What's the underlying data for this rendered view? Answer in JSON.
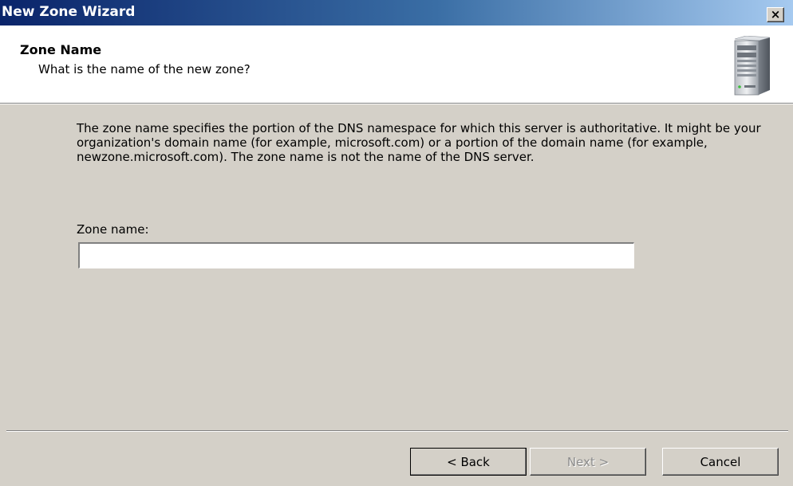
{
  "window": {
    "title": "New Zone Wizard",
    "close_label": "×"
  },
  "header": {
    "title": "Zone Name",
    "subtitle": "What is the name of the new zone?",
    "icon": "server-icon"
  },
  "body": {
    "description": "The zone name specifies the portion of the DNS namespace for which this server is authoritative. It might be your organization's domain name (for example,  microsoft.com) or a portion of the domain name (for example, newzone.microsoft.com). The zone name is not the name of the DNS server.",
    "zone_label": "Zone name:",
    "zone_value": ""
  },
  "buttons": {
    "back": "< Back",
    "next": "Next >",
    "cancel": "Cancel"
  },
  "colors": {
    "titlebar_start": "#0a246a",
    "titlebar_end": "#a6caf0",
    "dialog_bg": "#d4d0c8",
    "header_bg": "#ffffff"
  }
}
